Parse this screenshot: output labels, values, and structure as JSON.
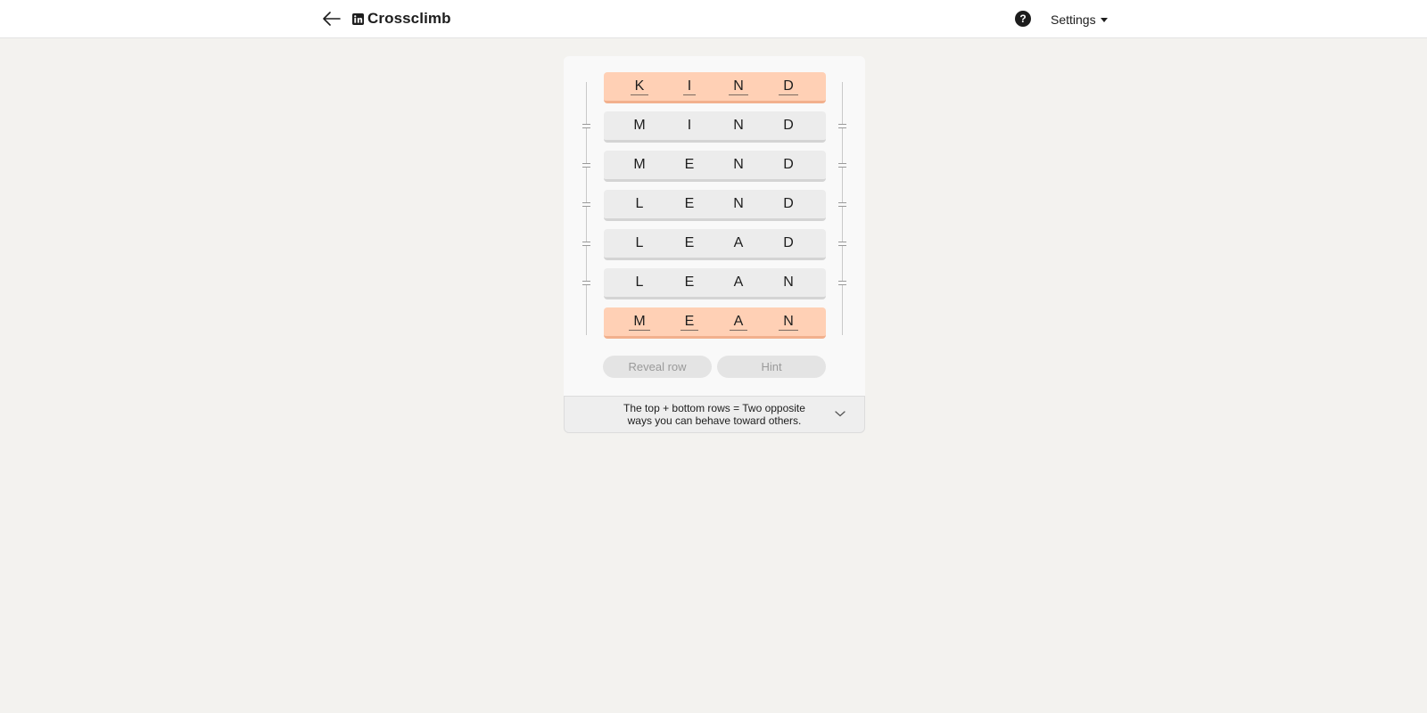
{
  "header": {
    "back_icon": "arrow-left-icon",
    "logo_icon": "linkedin-logo-icon",
    "title": "Crossclimb",
    "help_icon": "question-circle-icon",
    "settings_label": "Settings"
  },
  "puzzle": {
    "rows": [
      {
        "word": "KIND",
        "letters": [
          "K",
          "I",
          "N",
          "D"
        ],
        "type": "endpoint"
      },
      {
        "word": "MIND",
        "letters": [
          "M",
          "I",
          "N",
          "D"
        ],
        "type": "middle"
      },
      {
        "word": "MEND",
        "letters": [
          "M",
          "E",
          "N",
          "D"
        ],
        "type": "middle"
      },
      {
        "word": "LEND",
        "letters": [
          "L",
          "E",
          "N",
          "D"
        ],
        "type": "middle"
      },
      {
        "word": "LEAD",
        "letters": [
          "L",
          "E",
          "A",
          "D"
        ],
        "type": "middle"
      },
      {
        "word": "LEAN",
        "letters": [
          "L",
          "E",
          "A",
          "N"
        ],
        "type": "middle"
      },
      {
        "word": "MEAN",
        "letters": [
          "M",
          "E",
          "A",
          "N"
        ],
        "type": "endpoint"
      }
    ],
    "drag_handle_icon": "drag-handle-icon",
    "reveal_row_label": "Reveal row",
    "hint_label": "Hint"
  },
  "clue": {
    "text_line1": "The top + bottom rows = Two opposite",
    "text_line2": "ways you can behave toward others.",
    "expand_icon": "chevron-down-icon"
  },
  "colors": {
    "endpoint_row": "#ffd0b5",
    "middle_row": "#ececec",
    "page_background": "#f3f2ef"
  }
}
